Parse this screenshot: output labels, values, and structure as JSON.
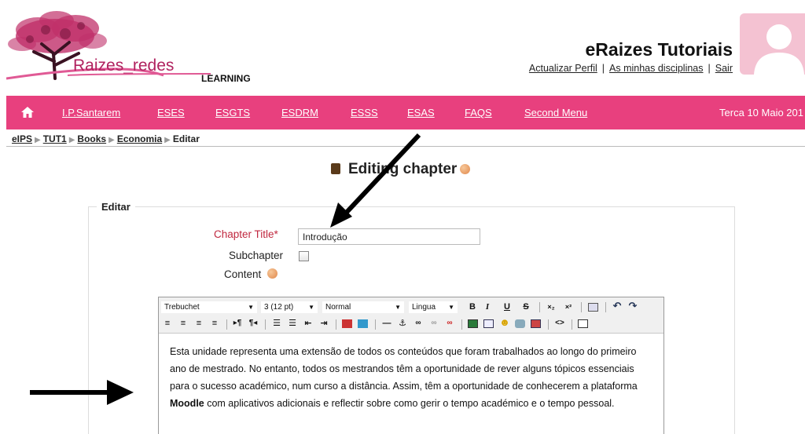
{
  "header": {
    "logo_text": "Raizes_redes",
    "logo_sub": "LEARNING",
    "site_title": "eRaizes Tutoriais",
    "user_links": [
      "Actualizar Perfil",
      "As minhas disciplinas",
      "Sair"
    ],
    "separator": "|"
  },
  "nav": {
    "items": [
      "I.P.Santarem",
      "ESES",
      "ESGTS",
      "ESDRM",
      "ESSS",
      "ESAS",
      "FAQS",
      "Second Menu"
    ],
    "date": "Terca 10 Maio 201",
    "accent": "#e8407e"
  },
  "breadcrumb": [
    "eIPS",
    "TUT1",
    "Books",
    "Economia",
    "Editar"
  ],
  "page": {
    "heading": "Editing chapter"
  },
  "form": {
    "legend": "Editar",
    "chapter_title_label": "Chapter Title",
    "required_mark": "*",
    "chapter_title_value": "Introdução",
    "subchapter_label": "Subchapter",
    "subchapter_checked": false,
    "content_label": "Content"
  },
  "editor": {
    "font_family": "Trebuchet",
    "font_size": "3 (12 pt)",
    "format": "Normal",
    "language": "Lingua",
    "btn_bold": "B",
    "btn_italic": "I",
    "btn_underline": "U",
    "btn_strike": "S",
    "body_before": "Esta unidade representa uma extensão de todos os conteúdos que foram trabalhados ao longo do primeiro ano de mestrado. No entanto, todos os mestrandos têm a oportunidade de rever alguns tópicos essenciais para o sucesso académico, num curso a distância. Assim, têm a oportunidade de conhecerem a plataforma ",
    "body_bold": "Moodle",
    "body_after": " com aplicativos adicionais e reflectir sobre como gerir o tempo académico e o tempo pessoal."
  },
  "icons": {
    "home": "home-icon",
    "help": "help-icon",
    "book": "book-icon"
  }
}
